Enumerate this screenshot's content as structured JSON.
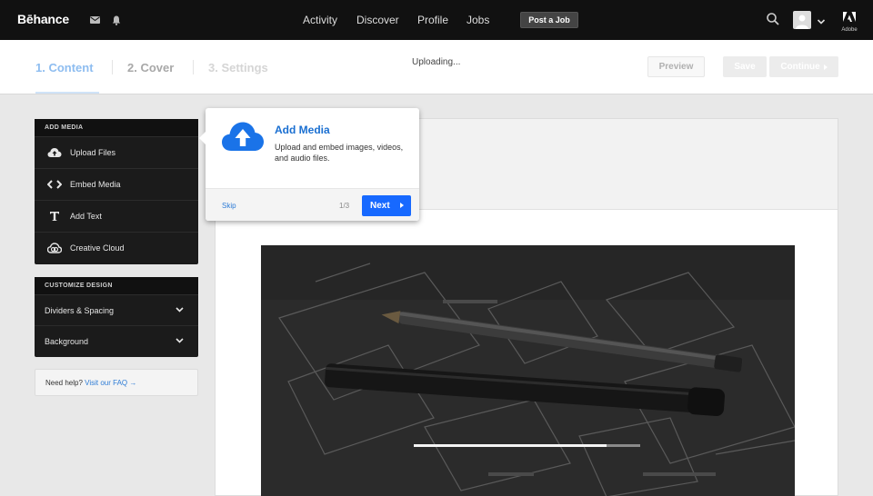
{
  "topnav": {
    "logo": "Bēhance",
    "links": [
      "Activity",
      "Discover",
      "Profile",
      "Jobs"
    ],
    "post_job": "Post a Job",
    "adobe_label": "Adobe"
  },
  "stepbar": {
    "steps": [
      "1.  Content",
      "2.  Cover",
      "3.  Settings"
    ],
    "status": "Uploading...",
    "preview": "Preview",
    "save": "Save",
    "continue": "Continue"
  },
  "sidebar": {
    "add_media": {
      "header": "ADD MEDIA",
      "items": [
        "Upload Files",
        "Embed Media",
        "Add Text",
        "Creative Cloud"
      ]
    },
    "customize": {
      "header": "CUSTOMIZE DESIGN",
      "items": [
        "Dividers & Spacing",
        "Background"
      ]
    },
    "help": {
      "text": "Need help?",
      "link": "Visit our FAQ →"
    }
  },
  "upload": {
    "progress": 0.85
  },
  "popover": {
    "title": "Add Media",
    "description": "Upload and embed images, videos, and audio files.",
    "skip": "Skip",
    "count": "1/3",
    "next": "Next"
  },
  "colors": {
    "accent": "#1769ff",
    "link": "#2e7cd6",
    "nav_bg": "#111111"
  }
}
